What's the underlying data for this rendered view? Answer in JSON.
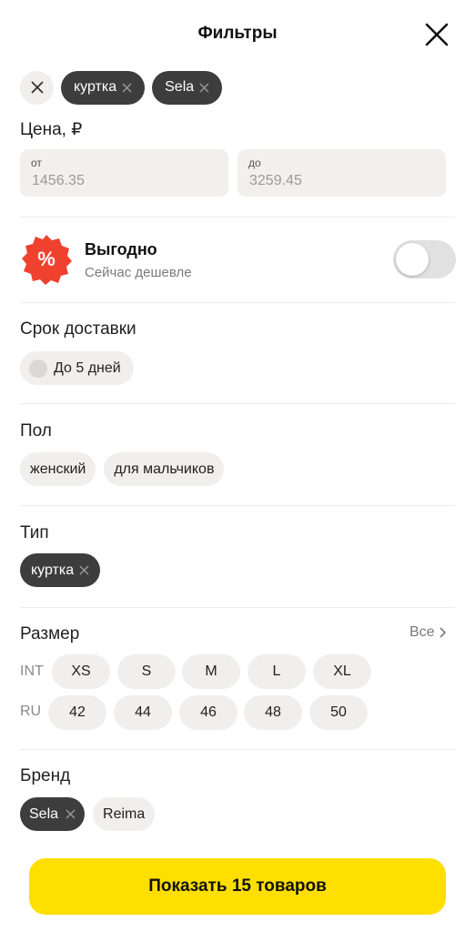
{
  "header": {
    "title": "Фильтры"
  },
  "active_filters": [
    {
      "label": "куртка"
    },
    {
      "label": "Sela"
    }
  ],
  "price": {
    "title": "Цена, ₽",
    "from_label": "от",
    "from_placeholder": "1456.35",
    "to_label": "до",
    "to_placeholder": "3259.45"
  },
  "promo": {
    "title": "Выгодно",
    "subtitle": "Сейчас дешевле",
    "icon_text": "%",
    "enabled": false
  },
  "delivery": {
    "title": "Срок доставки",
    "option": "До 5 дней"
  },
  "gender": {
    "title": "Пол",
    "options": [
      "женский",
      "для мальчиков"
    ]
  },
  "type": {
    "title": "Тип",
    "selected": "куртка"
  },
  "size": {
    "title": "Размер",
    "all_label": "Все",
    "int_label": "INT",
    "int_options": [
      "XS",
      "S",
      "M",
      "L",
      "XL"
    ],
    "ru_label": "RU",
    "ru_options": [
      "42",
      "44",
      "46",
      "48",
      "50"
    ]
  },
  "brand": {
    "title": "Бренд",
    "selected": "Sela",
    "options": [
      "Reima"
    ]
  },
  "show_button": {
    "label": "Показать 15 товаров"
  },
  "colors": {
    "accent_yellow": "#fedf00",
    "chip_dark": "#3d3d3d",
    "chip_light": "#f0efed",
    "promo_red": "#f0412f"
  }
}
